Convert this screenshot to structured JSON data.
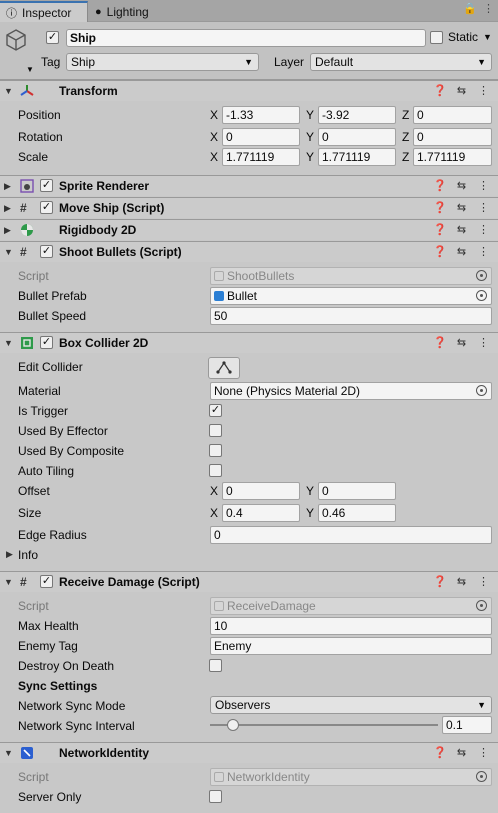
{
  "tabs": {
    "inspector": "Inspector",
    "lighting": "Lighting"
  },
  "gameobject": {
    "name": "Ship",
    "static_label": "Static",
    "tag_label": "Tag",
    "tag_value": "Ship",
    "layer_label": "Layer",
    "layer_value": "Default"
  },
  "transform": {
    "title": "Transform",
    "position_label": "Position",
    "rotation_label": "Rotation",
    "scale_label": "Scale",
    "axis_x": "X",
    "axis_y": "Y",
    "axis_z": "Z",
    "position": {
      "x": "-1.33",
      "y": "-3.92",
      "z": "0"
    },
    "rotation": {
      "x": "0",
      "y": "0",
      "z": "0"
    },
    "scale": {
      "x": "1.771119",
      "y": "1.771119",
      "z": "1.771119"
    }
  },
  "sprite_renderer": {
    "title": "Sprite Renderer"
  },
  "move_ship": {
    "title": "Move Ship (Script)"
  },
  "rigidbody": {
    "title": "Rigidbody 2D"
  },
  "shoot_bullets": {
    "title": "Shoot Bullets (Script)",
    "script_label": "Script",
    "script_value": "ShootBullets",
    "prefab_label": "Bullet Prefab",
    "prefab_value": "Bullet",
    "speed_label": "Bullet Speed",
    "speed_value": "50"
  },
  "box_collider": {
    "title": "Box Collider 2D",
    "edit_label": "Edit Collider",
    "material_label": "Material",
    "material_value": "None (Physics Material 2D)",
    "is_trigger_label": "Is Trigger",
    "is_trigger": true,
    "used_by_effector_label": "Used By Effector",
    "used_by_composite_label": "Used By Composite",
    "auto_tiling_label": "Auto Tiling",
    "offset_label": "Offset",
    "offset": {
      "x": "0",
      "y": "0"
    },
    "size_label": "Size",
    "size": {
      "x": "0.4",
      "y": "0.46"
    },
    "edge_radius_label": "Edge Radius",
    "edge_radius_value": "0",
    "info_label": "Info"
  },
  "receive_damage": {
    "title": "Receive Damage (Script)",
    "script_label": "Script",
    "script_value": "ReceiveDamage",
    "max_health_label": "Max Health",
    "max_health_value": "10",
    "enemy_tag_label": "Enemy Tag",
    "enemy_tag_value": "Enemy",
    "destroy_label": "Destroy On Death",
    "sync_header": "Sync Settings",
    "sync_mode_label": "Network Sync Mode",
    "sync_mode_value": "Observers",
    "sync_interval_label": "Network Sync Interval",
    "sync_interval_value": "0.1",
    "sync_interval_slider": 0.04
  },
  "network_identity": {
    "title": "NetworkIdentity",
    "script_label": "Script",
    "script_value": "NetworkIdentity",
    "server_only_label": "Server Only"
  },
  "colors": {
    "accent": "#3a72b0",
    "panel": "#c8c8c8"
  }
}
